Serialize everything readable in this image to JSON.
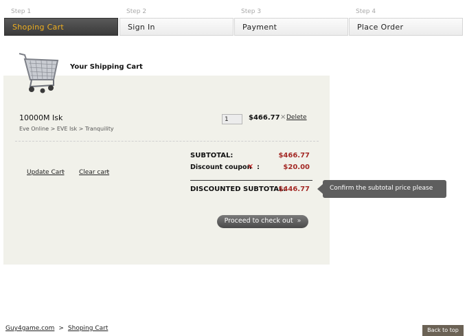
{
  "steps": [
    {
      "num": "Step 1",
      "label": "Shoping Cart",
      "active": true
    },
    {
      "num": "Step 2",
      "label": "Sign In",
      "active": false
    },
    {
      "num": "Step 3",
      "label": "Payment",
      "active": false
    },
    {
      "num": "Step 4",
      "label": "Place Order",
      "active": false
    }
  ],
  "cart": {
    "title": "Your Shipping Cart",
    "item": {
      "name": "10000M Isk",
      "path": "Eve Online > EVE Isk > Tranquility",
      "qty": "1",
      "price": "$466.77",
      "delete_label": "Delete"
    },
    "update_label": "Update Cart",
    "clear_label": "Clear cart",
    "subtotal_label": "SUBTOTAL:",
    "subtotal_value": "$466.77",
    "coupon_label": "Discount coupon",
    "coupon_colon": ":",
    "coupon_value": "$20.00",
    "discounted_label": "DISCOUNTED SUBTOTAL:",
    "discounted_value": "$446.77",
    "tooltip": "Confirm the subtotal price  please",
    "checkout_label": "Proceed to check out"
  },
  "footer": {
    "site": "Guy4game.com",
    "sep": ">",
    "current": "Shoping Cart",
    "back_to_top": "Back to top"
  },
  "colors": {
    "active_step_bg": "#444444",
    "active_step_text": "#f0b020",
    "price_red": "#a42a26",
    "panel_bg": "#f1f1ea"
  }
}
